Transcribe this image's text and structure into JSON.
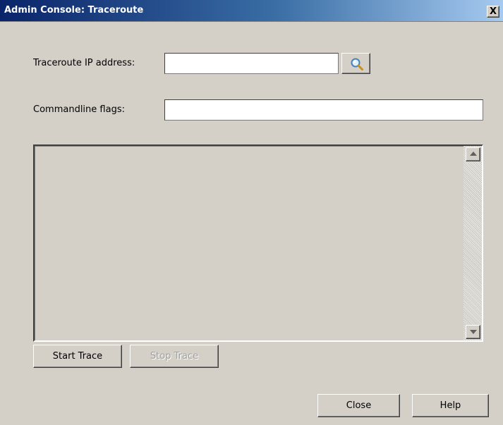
{
  "window": {
    "title": "Admin Console: Traceroute",
    "close_glyph": "X"
  },
  "form": {
    "ip_label": "Traceroute IP address:",
    "ip_value": "",
    "search_icon": "magnifier-icon",
    "flags_label": "Commandline flags:",
    "flags_value": ""
  },
  "output": {
    "text": ""
  },
  "trace_buttons": {
    "start": "Start Trace",
    "stop": "Stop Trace",
    "stop_disabled": true
  },
  "footer": {
    "close": "Close",
    "help": "Help"
  }
}
